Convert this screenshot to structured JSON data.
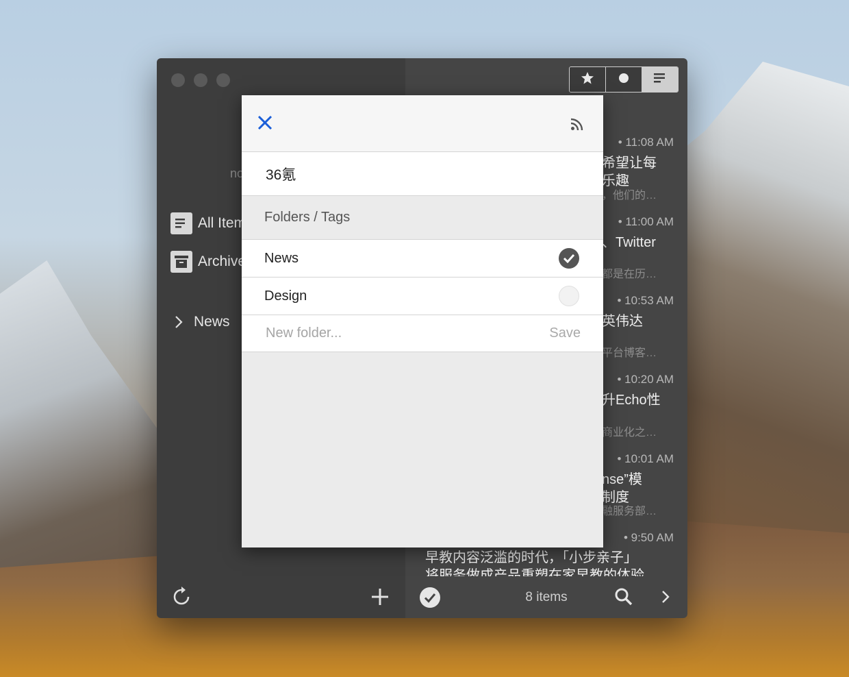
{
  "sidebar": {
    "account_partial": "no",
    "items": [
      {
        "label": "All Items",
        "icon": "list-icon"
      },
      {
        "label": "Archive",
        "icon": "archive-icon"
      }
    ],
    "folders": [
      {
        "label": "News",
        "icon": "chevron-right-icon"
      }
    ],
    "footer": {
      "refresh_icon": "refresh-icon",
      "add_icon": "plus-icon"
    }
  },
  "toolbar": {
    "buttons": [
      {
        "icon": "star-icon"
      },
      {
        "icon": "dot-icon"
      },
      {
        "icon": "lines-icon"
      }
    ]
  },
  "articles": [
    {
      "time": "• 11:08 AM",
      "line1": "希望让每",
      "line2": "乐趣",
      "summary": "，他们的…"
    },
    {
      "time": "• 11:00 AM",
      "line1": "、Twitter",
      "summary": "都是在历…"
    },
    {
      "time": "• 10:53 AM",
      "line1": "英伟达",
      "summary": "平台博客…"
    },
    {
      "time": "• 10:20 AM",
      "line1": "升Echo性",
      "summary": "商业化之…"
    },
    {
      "time": "• 10:01 AM",
      "line1": "nse”模",
      "line2": "制度",
      "summary": "融服务部…"
    },
    {
      "time": "• 9:50 AM",
      "line1": "早教内容泛滥的时代，「小步亲子」",
      "line2": "将服务做成产品重塑在家早教的体验"
    }
  ],
  "list_footer": {
    "count": "8 items",
    "mark_all_icon": "check-circle-icon",
    "search_icon": "search-icon",
    "next_icon": "chevron-right-icon"
  },
  "modal": {
    "close_icon": "close-icon",
    "rss_icon": "rss-icon",
    "feed_name": "36氪",
    "section_title": "Folders / Tags",
    "folders": [
      {
        "name": "News",
        "checked": true
      },
      {
        "name": "Design",
        "checked": false
      }
    ],
    "new_folder_placeholder": "New folder...",
    "save_label": "Save",
    "accent_color": "#1a5ed8"
  }
}
